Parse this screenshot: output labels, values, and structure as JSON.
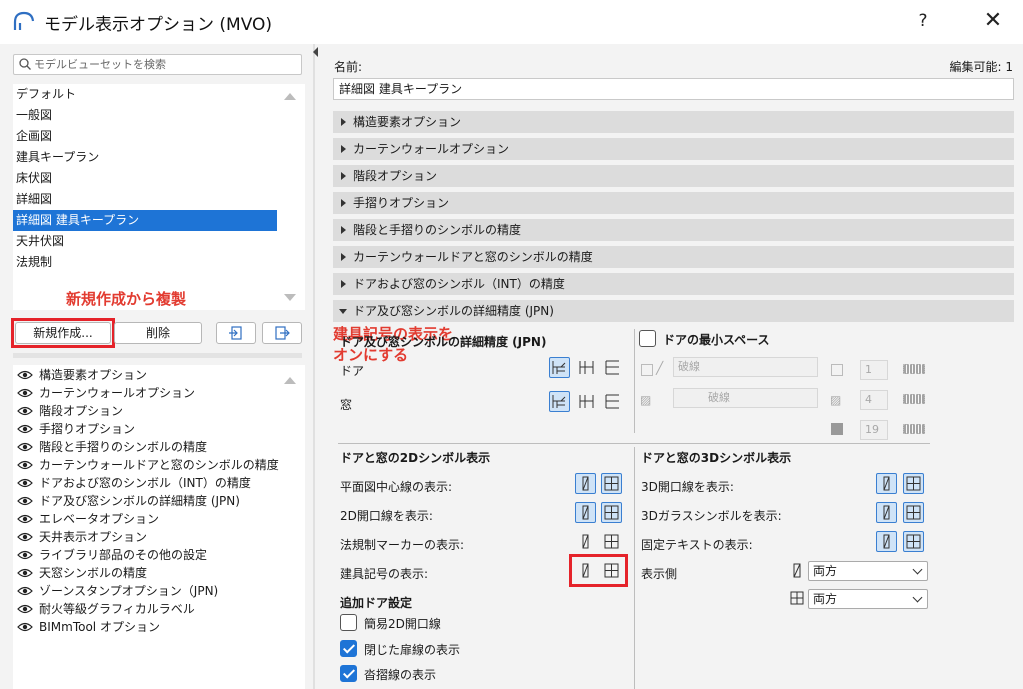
{
  "window": {
    "title": "モデル表示オプション (MVO)",
    "help": "?",
    "close": "✕"
  },
  "left": {
    "search_placeholder": "モデルビューセットを検索",
    "views": [
      "デフォルト",
      "一般図",
      "企画図",
      "建具キープラン",
      "床伏図",
      "詳細図",
      "詳細図 建具キープラン",
      "天井伏図",
      "法規制"
    ],
    "selected_index": 6,
    "annotation_new": "新規作成から複製",
    "buttons": {
      "new": "新規作成...",
      "delete": "削除"
    },
    "options": [
      "構造要素オプション",
      "カーテンウォールオプション",
      "階段オプション",
      "手摺りオプション",
      "階段と手摺りのシンボルの精度",
      "カーテンウォールドアと窓のシンボルの精度",
      "ドアおよび窓のシンボル（INT）の精度",
      "ドア及び窓シンボルの詳細精度 (JPN)",
      "エレベータオプション",
      "天井表示オプション",
      "ライブラリ部品のその他の設定",
      "天窓シンボルの精度",
      "ゾーンスタンプオプション（JPN)",
      "耐火等級グラフィカルラベル",
      "BIMmTool オプション"
    ]
  },
  "right": {
    "name_label": "名前:",
    "editable_label": "編集可能: 1",
    "name_value": "詳細図 建具キープラン",
    "sections": [
      "構造要素オプション",
      "カーテンウォールオプション",
      "階段オプション",
      "手摺りオプション",
      "階段と手摺りのシンボルの精度",
      "カーテンウォールドアと窓のシンボルの精度",
      "ドアおよび窓のシンボル（INT）の精度",
      "ドア及び窓シンボルの詳細精度 (JPN)"
    ],
    "panel": {
      "detail_header": "ドア及び窓シンボルの詳細精度 (JPN)",
      "door_label": "ドア",
      "window_label": "窓",
      "min_space_label": "ドアの最小スペース",
      "line_type1": "破線",
      "line_type2": "破線",
      "pen1": "1",
      "pen2": "4",
      "pen3": "19",
      "sym2d_header": "ドアと窓の2Dシンボル表示",
      "sym2d_rows": [
        "平面図中心線の表示:",
        "2D開口線を表示:",
        "法規制マーカーの表示:",
        "建具記号の表示:"
      ],
      "extra_header": "追加ドア設定",
      "extra_rows": [
        {
          "label": "簡易2D開口線",
          "checked": false
        },
        {
          "label": "閉じた扉線の表示",
          "checked": true
        },
        {
          "label": "沓摺線の表示",
          "checked": true
        }
      ],
      "sym3d_header": "ドアと窓の3Dシンボル表示",
      "sym3d_rows": [
        "3D開口線を表示:",
        "3Dガラスシンボルを表示:",
        "固定テキストの表示:"
      ],
      "side_label": "表示側",
      "side_door_value": "両方",
      "side_window_value": "両方",
      "annotation_line1": "建具記号の表示を",
      "annotation_line2": "オンにする"
    }
  },
  "colors": {
    "accent": "#1e74d6",
    "annotation": "#e23b30",
    "highlight_box": "#e5232a"
  }
}
